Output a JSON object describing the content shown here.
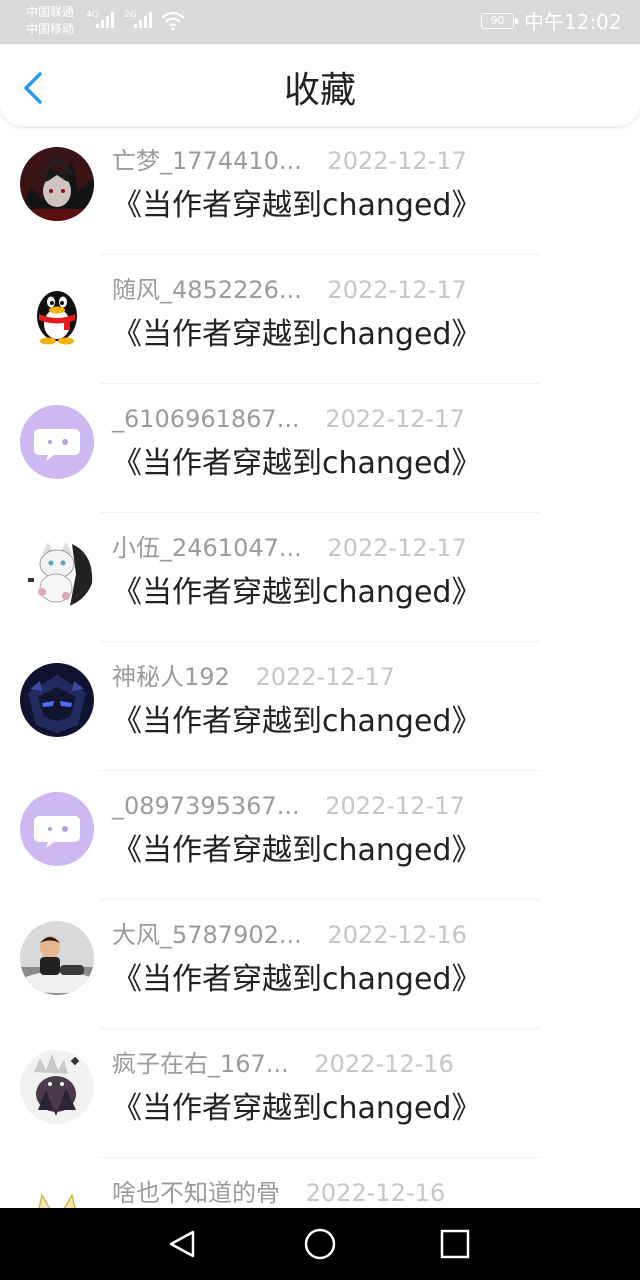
{
  "status_bar": {
    "carrier1": "中国联通",
    "carrier2": "中国移动",
    "net1": "4G",
    "net2": "2G",
    "battery": "90",
    "time": "中午12:02"
  },
  "header": {
    "title": "收藏"
  },
  "items": [
    {
      "username": "亡梦_1774410...",
      "date": "2022-12-17",
      "title": "《当作者穿越到changed》",
      "avatar": "dark-anime-avatar"
    },
    {
      "username": "随风_4852226...",
      "date": "2022-12-17",
      "title": "《当作者穿越到changed》",
      "avatar": "penguin-avatar"
    },
    {
      "username": "_6106961867...",
      "date": "2022-12-17",
      "title": "《当作者穿越到changed》",
      "avatar": "default-chat-avatar"
    },
    {
      "username": "小伍_2461047...",
      "date": "2022-12-17",
      "title": "《当作者穿越到changed》",
      "avatar": "white-fox-avatar"
    },
    {
      "username": "神秘人192",
      "date": "2022-12-17",
      "title": "《当作者穿越到changed》",
      "avatar": "robot-avatar"
    },
    {
      "username": "_0897395367...",
      "date": "2022-12-17",
      "title": "《当作者穿越到changed》",
      "avatar": "default-chat-avatar"
    },
    {
      "username": "大风_5787902...",
      "date": "2022-12-16",
      "title": "《当作者穿越到changed》",
      "avatar": "child-photo-avatar"
    },
    {
      "username": "疯子在右_167...",
      "date": "2022-12-16",
      "title": "《当作者穿越到changed》",
      "avatar": "gray-character-avatar"
    },
    {
      "username": "啥也不知道的骨",
      "date": "2022-12-16",
      "title": "",
      "avatar": "cat-ears-avatar"
    }
  ],
  "colors": {
    "accent": "#2b9af3",
    "status_bar_bg": "#d9d9d9",
    "username": "#9b9b9b",
    "date": "#c6c6c6",
    "title_text": "#222222",
    "default_avatar": "#cdb8f2"
  }
}
